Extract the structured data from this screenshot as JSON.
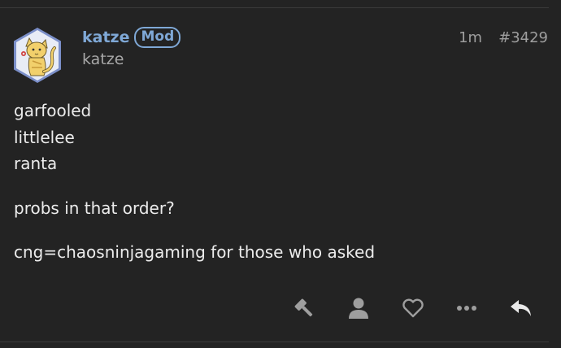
{
  "post": {
    "username": "katze",
    "badge": "Mod",
    "full_name": "katze",
    "time_ago": "1m",
    "post_number": "#3429",
    "paragraphs": [
      [
        "garfooled",
        "littlelee",
        "ranta"
      ],
      [
        "probs in that order?"
      ],
      [
        "cng=chaosninjagaming for those who asked"
      ]
    ]
  },
  "actions": [
    {
      "name": "admin-gavel-icon"
    },
    {
      "name": "user-icon"
    },
    {
      "name": "like-heart-icon"
    },
    {
      "name": "more-ellipsis-icon"
    },
    {
      "name": "reply-icon"
    }
  ],
  "colors": {
    "background": "#232323",
    "username": "#7fa8d6",
    "meta": "#9e9e9e",
    "icon": "#9e9e9e",
    "reply_icon": "#e9e9e9"
  }
}
